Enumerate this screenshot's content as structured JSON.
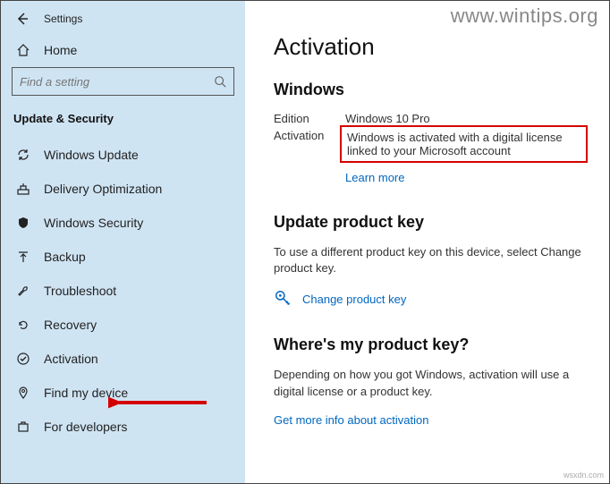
{
  "header": {
    "title": "Settings"
  },
  "home": {
    "label": "Home"
  },
  "search": {
    "placeholder": "Find a setting"
  },
  "category": "Update & Security",
  "nav": [
    {
      "label": "Windows Update"
    },
    {
      "label": "Delivery Optimization"
    },
    {
      "label": "Windows Security"
    },
    {
      "label": "Backup"
    },
    {
      "label": "Troubleshoot"
    },
    {
      "label": "Recovery"
    },
    {
      "label": "Activation"
    },
    {
      "label": "Find my device"
    },
    {
      "label": "For developers"
    }
  ],
  "main": {
    "title": "Activation",
    "windows_heading": "Windows",
    "edition_label": "Edition",
    "edition_value": "Windows 10 Pro",
    "activation_label": "Activation",
    "activation_value": "Windows is activated with a digital license linked to your Microsoft account",
    "learn_more": "Learn more",
    "update_key_heading": "Update product key",
    "update_key_body": "To use a different product key on this device, select Change product key.",
    "change_key": "Change product key",
    "where_heading": "Where's my product key?",
    "where_body": "Depending on how you got Windows, activation will use a digital license or a product key.",
    "get_more": "Get more info about activation"
  },
  "watermark": "www.wintips.org",
  "footer": "wsxdn.com"
}
